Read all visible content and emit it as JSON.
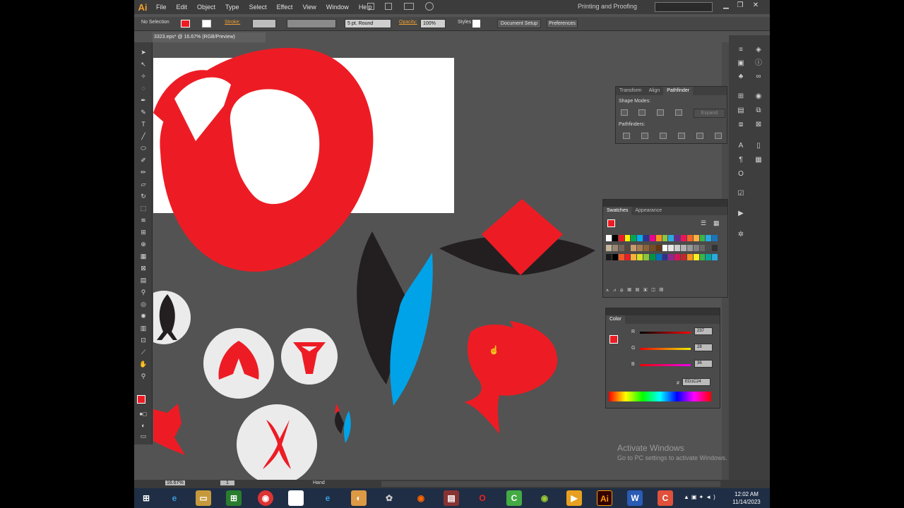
{
  "app": {
    "logo": "Ai"
  },
  "menu": [
    "File",
    "Edit",
    "Object",
    "Type",
    "Select",
    "Effect",
    "View",
    "Window",
    "Help"
  ],
  "workspace": "Printing and Proofing",
  "control_bar": {
    "selection": "No Selection",
    "stroke_label": "Stroke:",
    "brush": "5 pt. Round",
    "opacity_label": "Opacity:",
    "opacity_value": "100%",
    "styles_label": "Styles",
    "document_setup": "Document Setup",
    "preferences": "Preferences"
  },
  "document_tab": "3323.eps* @ 16.67% (RGB/Preview)",
  "pathfinder_panel": {
    "tabs": [
      "Transform",
      "Align",
      "Pathfinder"
    ],
    "active_tab": "Pathfinder",
    "shape_modes": "Shape Modes:",
    "expand": "Expand",
    "pathfinders": "Pathfinders:"
  },
  "swatches_panel": {
    "tabs": [
      "Swatches",
      "Appearance"
    ],
    "active_tab": "Swatches"
  },
  "color_panel": {
    "title": "Color",
    "r_label": "R",
    "r_value": "237",
    "r": 237,
    "g_label": "G",
    "g_value": "28",
    "g": 28,
    "b_label": "B",
    "b_value": "36",
    "b": 36,
    "hex_label": "#",
    "hex": "ED1C24"
  },
  "status_bar": {
    "zoom": "16.67%",
    "page": "1",
    "tool": "Hand"
  },
  "watermark": {
    "title": "Activate Windows",
    "subtitle": "Go to PC settings to activate Windows."
  },
  "taskbar": {
    "time": "12:02 AM",
    "date": "11/14/2023"
  },
  "colors": {
    "accent": "#ED1C24",
    "blue": "#00A3E8",
    "dark": "#231F20",
    "ui_bg": "#535353"
  },
  "icons": [
    "selection-tool-icon",
    "direct-selection-icon",
    "magic-wand-icon",
    "lasso-icon",
    "pen-icon",
    "type-icon",
    "line-icon",
    "ellipse-icon",
    "paintbrush-icon",
    "pencil-icon",
    "eraser-icon",
    "rotate-icon",
    "scale-icon",
    "warp-icon",
    "free-transform-icon",
    "symbol-sprayer-icon",
    "graph-icon",
    "artboard-icon",
    "slice-icon",
    "hand-icon",
    "zoom-icon"
  ]
}
